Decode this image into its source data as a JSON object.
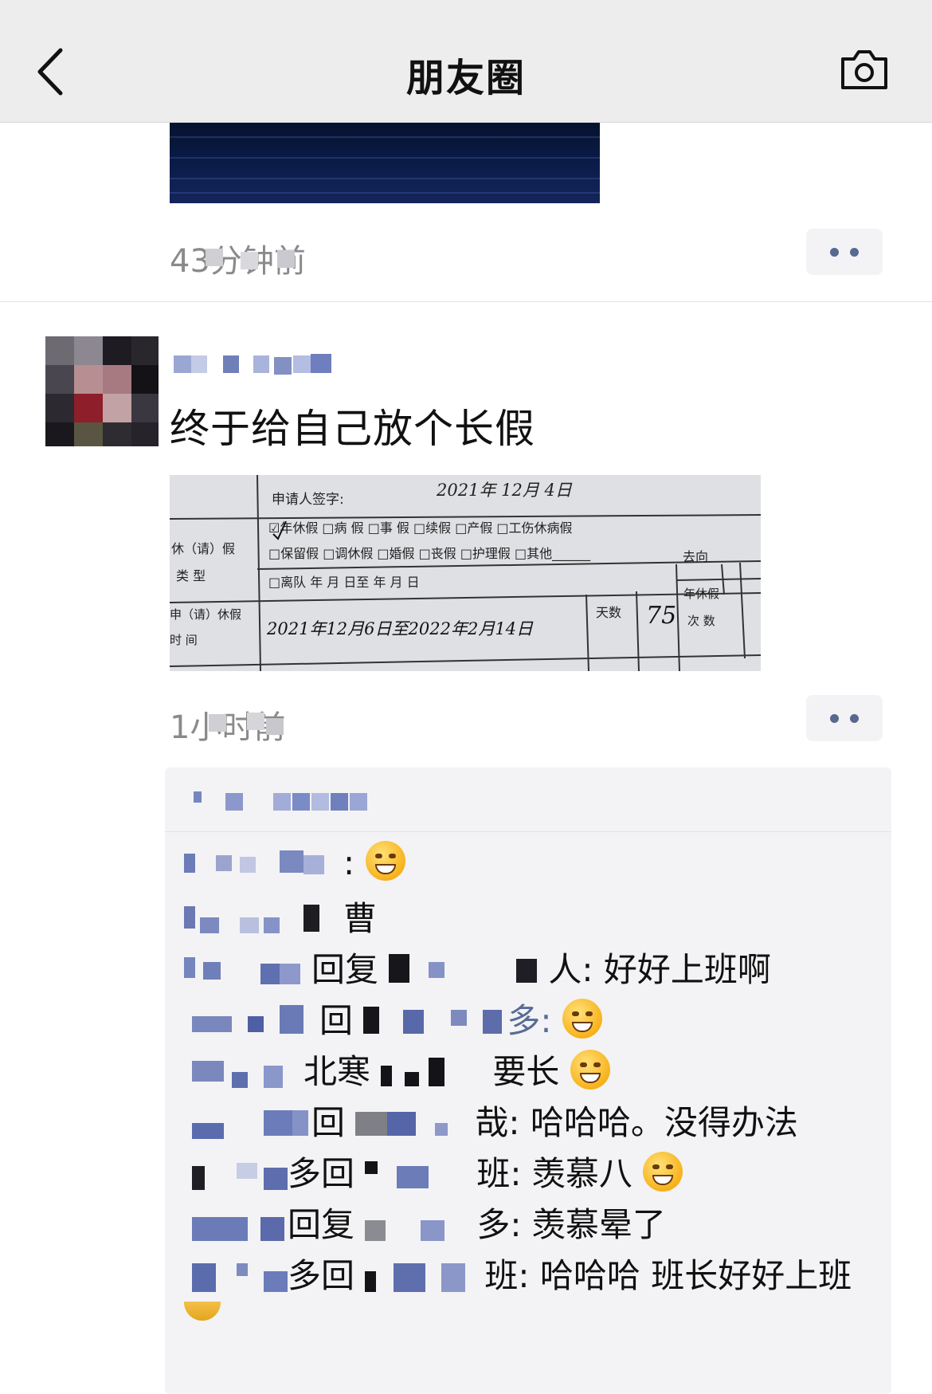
{
  "nav": {
    "title": "朋友圈",
    "back_icon": "chevron-left-icon",
    "camera_icon": "camera-icon"
  },
  "previous_post": {
    "time": "43分钟前"
  },
  "post": {
    "text": "终于给自己放个长假",
    "time": "1小时前",
    "form": {
      "signature_label": "申请人签字:",
      "signature_date": "2021年  12月  4日",
      "type_label_1": "休（请）假",
      "type_label_2": "类    型",
      "row1": "☑年休假   □病   假   □事   假  □续假  □产假   □工伤休病假",
      "row2": "□保留假   □调休假   □婚假     □丧假  □护理假  □其他______",
      "row3": "□离队      年    月   日至      年    月    日",
      "destination_label": "去向",
      "time_label_1": "申（请）休假",
      "time_label_2": "时  间",
      "leave_period": "2021年12月6日至2022年2月14日",
      "days_label": "天数",
      "days_value": "75",
      "annual_label_1": "年休假",
      "annual_label_2": "次  数"
    }
  },
  "comments": [
    {
      "text": ":"
    },
    {
      "text": "曹"
    },
    {
      "text": "回复",
      "text2": "人: 好好上班啊"
    },
    {
      "text": "回",
      "text2": "多:"
    },
    {
      "text": "北寒",
      "text2": "要长"
    },
    {
      "text": "回",
      "text2": "哉: 哈哈哈。没得办法"
    },
    {
      "text": "多回",
      "text2": "班: 羡慕八"
    },
    {
      "text": "回复",
      "text2": "多: 羡慕晕了"
    },
    {
      "text": "多回",
      "text2": "班: 哈哈哈 班长好好上班"
    }
  ],
  "colors": {
    "link": "#576b95",
    "nav_bg": "#ededed",
    "comment_bg": "#f3f3f5"
  }
}
